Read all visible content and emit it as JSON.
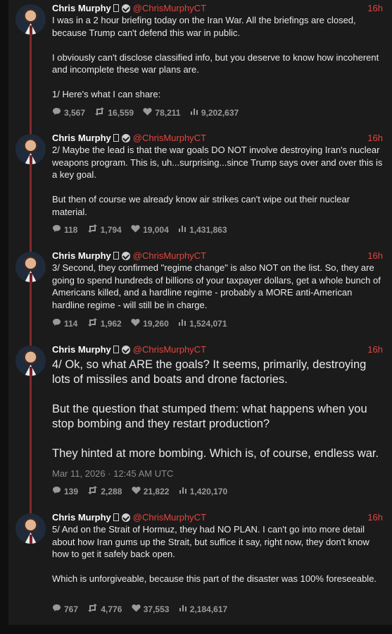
{
  "tweets": [
    {
      "name": "Chris Murphy",
      "handle": "@ChrisMurphyCT",
      "time": "16h",
      "text": "I was in a 2 hour briefing today on the Iran War. All the briefings are closed, because Trump can't defend this war in public.\n\nI obviously can't disclose classified info, but you deserve to know how incoherent and incomplete these war plans are.\n\n1/ Here's what I can share:",
      "replies": "3,567",
      "retweets": "16,559",
      "likes": "78,211",
      "views": "9,202,637"
    },
    {
      "name": "Chris Murphy",
      "handle": "@ChrisMurphyCT",
      "time": "16h",
      "text": "2/ Maybe the lead is that the war goals DO NOT involve destroying Iran's nuclear weapons program. This is, uh...surprising...since Trump says over and over this is a key goal.\n\nBut then of course we already know air strikes can't wipe out their nuclear material.",
      "replies": "118",
      "retweets": "1,794",
      "likes": "19,004",
      "views": "1,431,863"
    },
    {
      "name": "Chris Murphy",
      "handle": "@ChrisMurphyCT",
      "time": "16h",
      "text": "3/ Second, they confirmed \"regime change\" is also NOT on the list. So, they are going to spend hundreds of billions of your taxpayer dollars, get a whole bunch of Americans killed, and a hardline regime - probably a MORE anti-American hardline regime - will still be in charge.",
      "replies": "114",
      "retweets": "1,962",
      "likes": "19,260",
      "views": "1,524,071"
    },
    {
      "name": "Chris Murphy",
      "handle": "@ChrisMurphyCT",
      "time": "16h",
      "text": "4/ Ok, so what ARE the goals? It seems, primarily, destroying lots of missiles and boats and drone factories.\n\nBut the question that stumped them: what happens when you stop bombing and they restart production?\n\nThey hinted at more bombing. Which is, of course, endless war.",
      "date": "Mar 11, 2026 · 12:45 AM UTC",
      "replies": "139",
      "retweets": "2,288",
      "likes": "21,822",
      "views": "1,420,170"
    },
    {
      "name": "Chris Murphy",
      "handle": "@ChrisMurphyCT",
      "time": "16h",
      "text": "5/ And on the Strait of Hormuz, they had NO PLAN. I can't go into more detail about how Iran gums up the Strait, but suffice it say, right now, they don't know how to get it safely back open.\n\nWhich is unforgiveable, because this part of the disaster was 100% foreseeable.",
      "replies": "767",
      "retweets": "4,776",
      "likes": "37,553",
      "views": "2,184,617"
    }
  ],
  "colors": {
    "accent": "#e0463f",
    "thread": "#7e2a2a",
    "background": "#1b1b1b"
  },
  "icons": [
    "reply-icon",
    "retweet-icon",
    "like-icon",
    "views-icon",
    "verified-icon"
  ]
}
